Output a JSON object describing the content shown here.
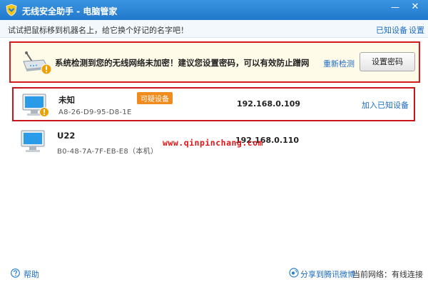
{
  "window": {
    "title": "无线安全助手 - 电脑管家",
    "minimize_glyph": "—",
    "close_glyph": "✕"
  },
  "hintbar": {
    "text": "试试把鼠标移到机器名上，给它换个好记的名字吧！",
    "known_devices_link": "已知设备",
    "settings_link": "设置"
  },
  "alert": {
    "message": "系统检测到您的无线网络未加密！建议您设置密码，可以有效防止蹭网",
    "recheck_link": "重新检测",
    "set_password_button": "设置密码"
  },
  "devices": [
    {
      "name": "未知",
      "mac": "A8-26-D9-95-D8-1E",
      "badge": "可疑设备",
      "ip": "192.168.0.109",
      "action": "加入已知设备"
    },
    {
      "name": "U22",
      "mac": "B0-48-7A-7F-EB-E8（本机）",
      "ip": "192.168.0.110"
    }
  ],
  "watermark": "www.qinpinchang.com",
  "footer": {
    "help": "帮助",
    "share": "分享到腾讯微博",
    "network_status": "当前网络：有线连接"
  },
  "colors": {
    "titlebar": "#2a82d4",
    "alert_border": "#d21b1b",
    "link": "#1b6bc4",
    "badge": "#f08c1e"
  }
}
